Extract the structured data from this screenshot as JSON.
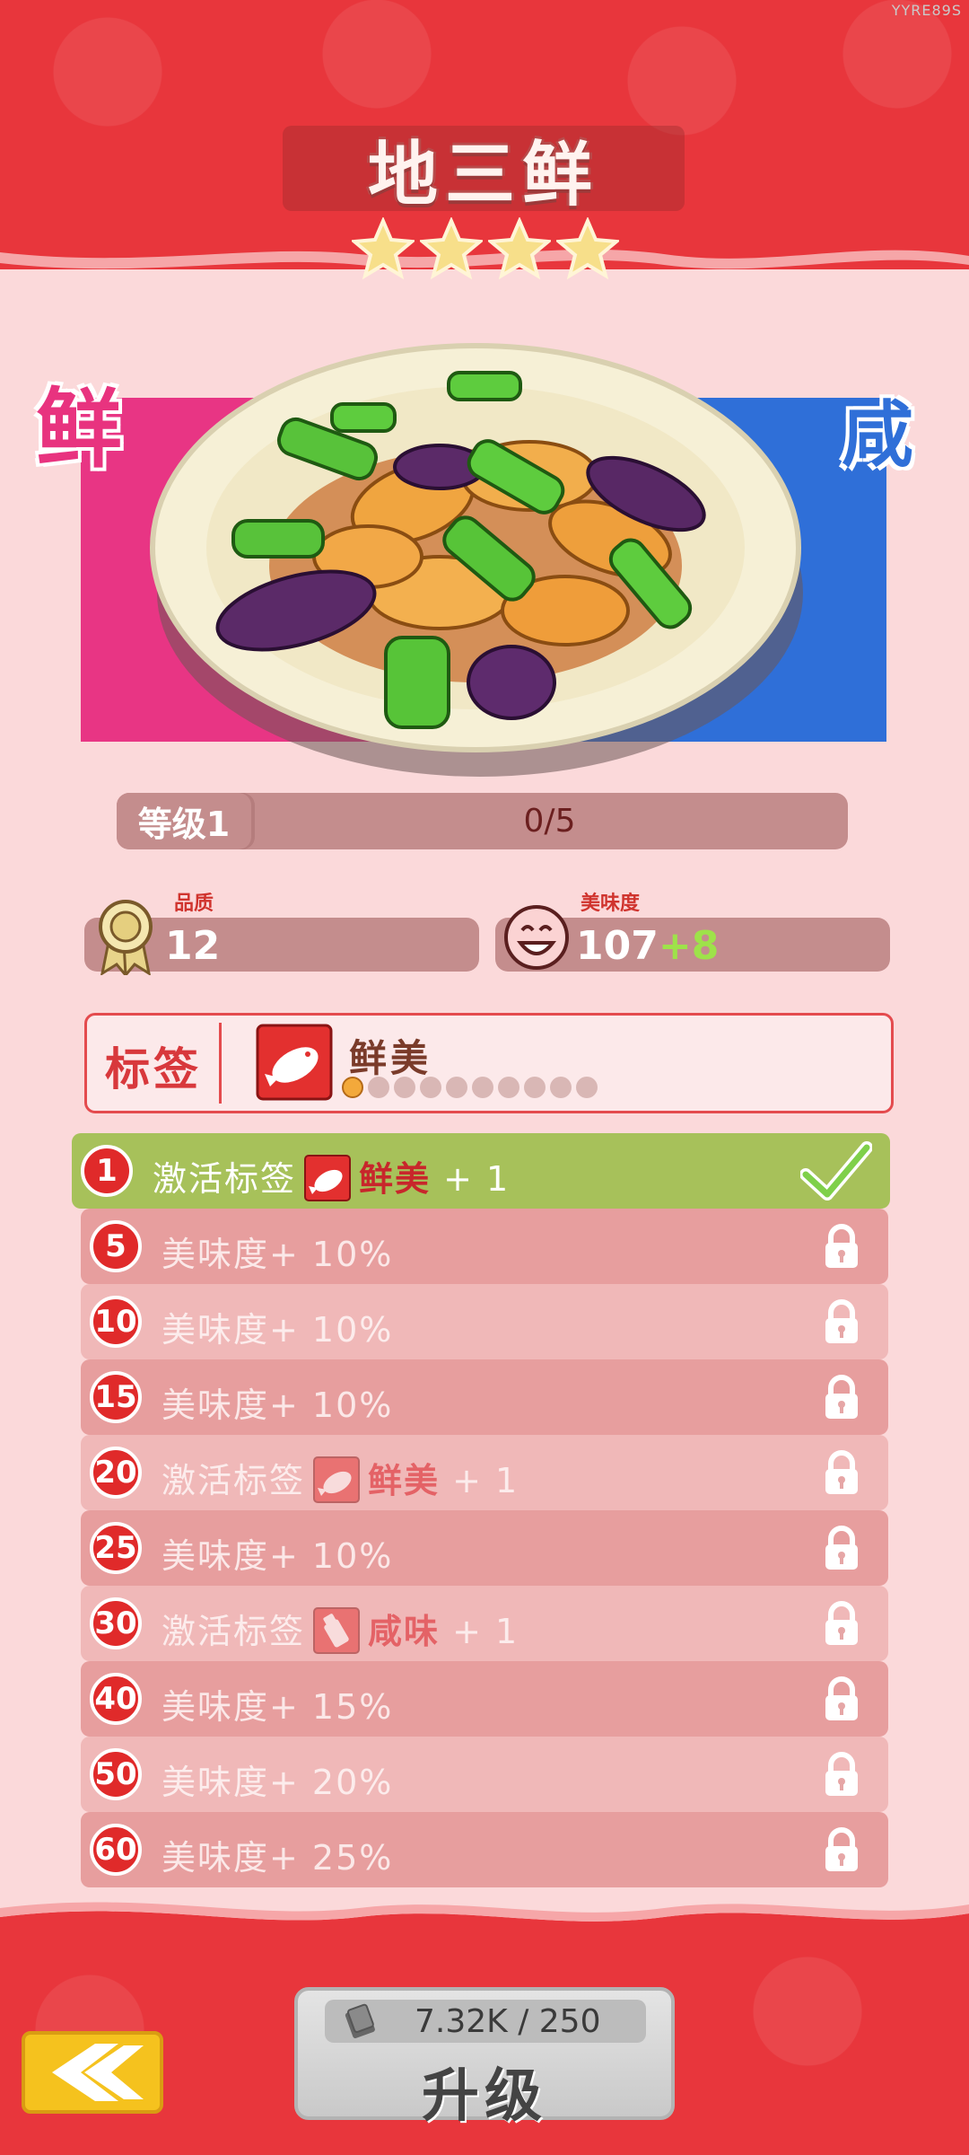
{
  "watermark": "YYRE89S",
  "dish": {
    "name": "地三鲜",
    "stars": 4,
    "star_color": "#f7df8a"
  },
  "tastes": {
    "left": "鲜",
    "right": "咸",
    "left_color": "#e83584",
    "right_color": "#2f6fd8"
  },
  "level": {
    "label": "等级1",
    "progress_text": "0/5"
  },
  "quality": {
    "caption": "品质",
    "value": "12"
  },
  "tastiness": {
    "caption": "美味度",
    "value": "107",
    "bonus": "+8"
  },
  "tag": {
    "title": "标签",
    "name": "鲜美",
    "dots_total": 10,
    "dots_filled": 1
  },
  "milestones": [
    {
      "level": "1",
      "text": "激活标签",
      "tag_name": "鲜美",
      "suffix": "+ 1",
      "kind": "tag",
      "icon": "fish-tag-icon",
      "status": "done"
    },
    {
      "level": "5",
      "text": "美味度+ 10%",
      "kind": "stat",
      "status": "locked"
    },
    {
      "level": "10",
      "text": "美味度+ 10%",
      "kind": "stat",
      "status": "locked"
    },
    {
      "level": "15",
      "text": "美味度+ 10%",
      "kind": "stat",
      "status": "locked"
    },
    {
      "level": "20",
      "text": "激活标签",
      "tag_name": "鲜美",
      "suffix": "+ 1",
      "kind": "tag",
      "icon": "fish-tag-icon",
      "status": "locked"
    },
    {
      "level": "25",
      "text": "美味度+ 10%",
      "kind": "stat",
      "status": "locked"
    },
    {
      "level": "30",
      "text": "激活标签",
      "tag_name": "咸味",
      "suffix": "+ 1",
      "kind": "tag",
      "icon": "salt-tag-icon",
      "status": "locked"
    },
    {
      "level": "40",
      "text": "美味度+ 15%",
      "kind": "stat",
      "status": "locked"
    },
    {
      "level": "50",
      "text": "美味度+ 20%",
      "kind": "stat",
      "status": "locked"
    },
    {
      "level": "60",
      "text": "美味度+ 25%",
      "kind": "stat",
      "status": "locked"
    }
  ],
  "upgrade": {
    "cost": "7.32K / 250",
    "label": "升级"
  },
  "back_button": {
    "icon": "back-arrow-icon"
  }
}
